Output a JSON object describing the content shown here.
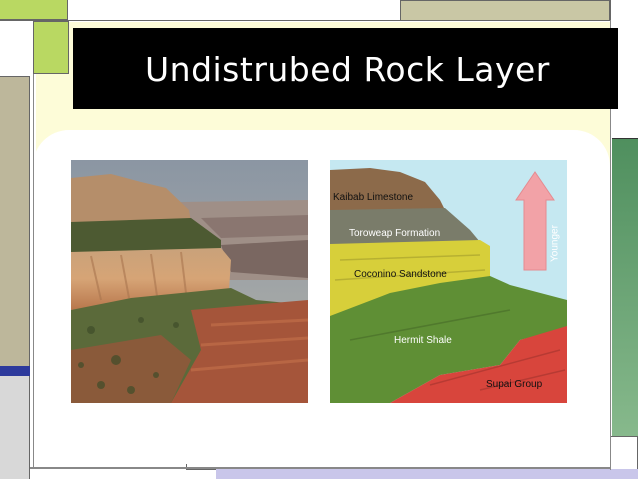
{
  "slide": {
    "title": "Undistrubed Rock Layer"
  },
  "diagram": {
    "layers": [
      {
        "label": "Kaibab Limestone",
        "color": "#8c6a4a"
      },
      {
        "label": "Toroweap Formation",
        "color": "#7a7c6a"
      },
      {
        "label": "Coconino Sandstone",
        "color": "#d7cf3a"
      },
      {
        "label": "Hermit Shale",
        "color": "#5f8f35"
      },
      {
        "label": "Supai Group",
        "color": "#d8453c"
      }
    ],
    "arrow_label": "Younger",
    "arrow_color": "#f2a2a7",
    "sky_color": "#c5e8f1"
  },
  "colors": {
    "title_bar": "#000000",
    "accent_green": "#b9d862",
    "accent_khaki": "#bdb79b",
    "accent_blue": "#2d3a9c",
    "panel_cream": "#fdfcd8"
  }
}
